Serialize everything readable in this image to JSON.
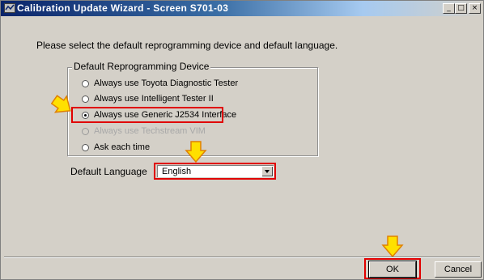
{
  "window": {
    "title": "Calibration Update Wizard - Screen S701-03",
    "controls": {
      "minimize": "_",
      "maximize": "□",
      "close": "×"
    }
  },
  "instruction": "Please select the default reprogramming device and default language.",
  "device_group": {
    "legend": "Default Reprogramming Device",
    "options": [
      {
        "label": "Always use Toyota Diagnostic Tester",
        "selected": false,
        "enabled": true
      },
      {
        "label": "Always use Intelligent Tester II",
        "selected": false,
        "enabled": true
      },
      {
        "label": "Always use Generic J2534 Interface",
        "selected": true,
        "enabled": true
      },
      {
        "label": "Always use Techstream VIM",
        "selected": false,
        "enabled": false
      },
      {
        "label": "Ask each time",
        "selected": false,
        "enabled": true
      }
    ]
  },
  "language": {
    "label": "Default Language",
    "selected": "English"
  },
  "buttons": {
    "ok": "OK",
    "cancel": "Cancel"
  },
  "colors": {
    "highlight_box": "#e00000",
    "arrow_fill": "#ffe000",
    "arrow_stroke": "#e08000",
    "title_bar": "#0a246a"
  },
  "icons": {
    "title": "calibration-app-icon",
    "pointer": "yellow-arrow-icon"
  }
}
